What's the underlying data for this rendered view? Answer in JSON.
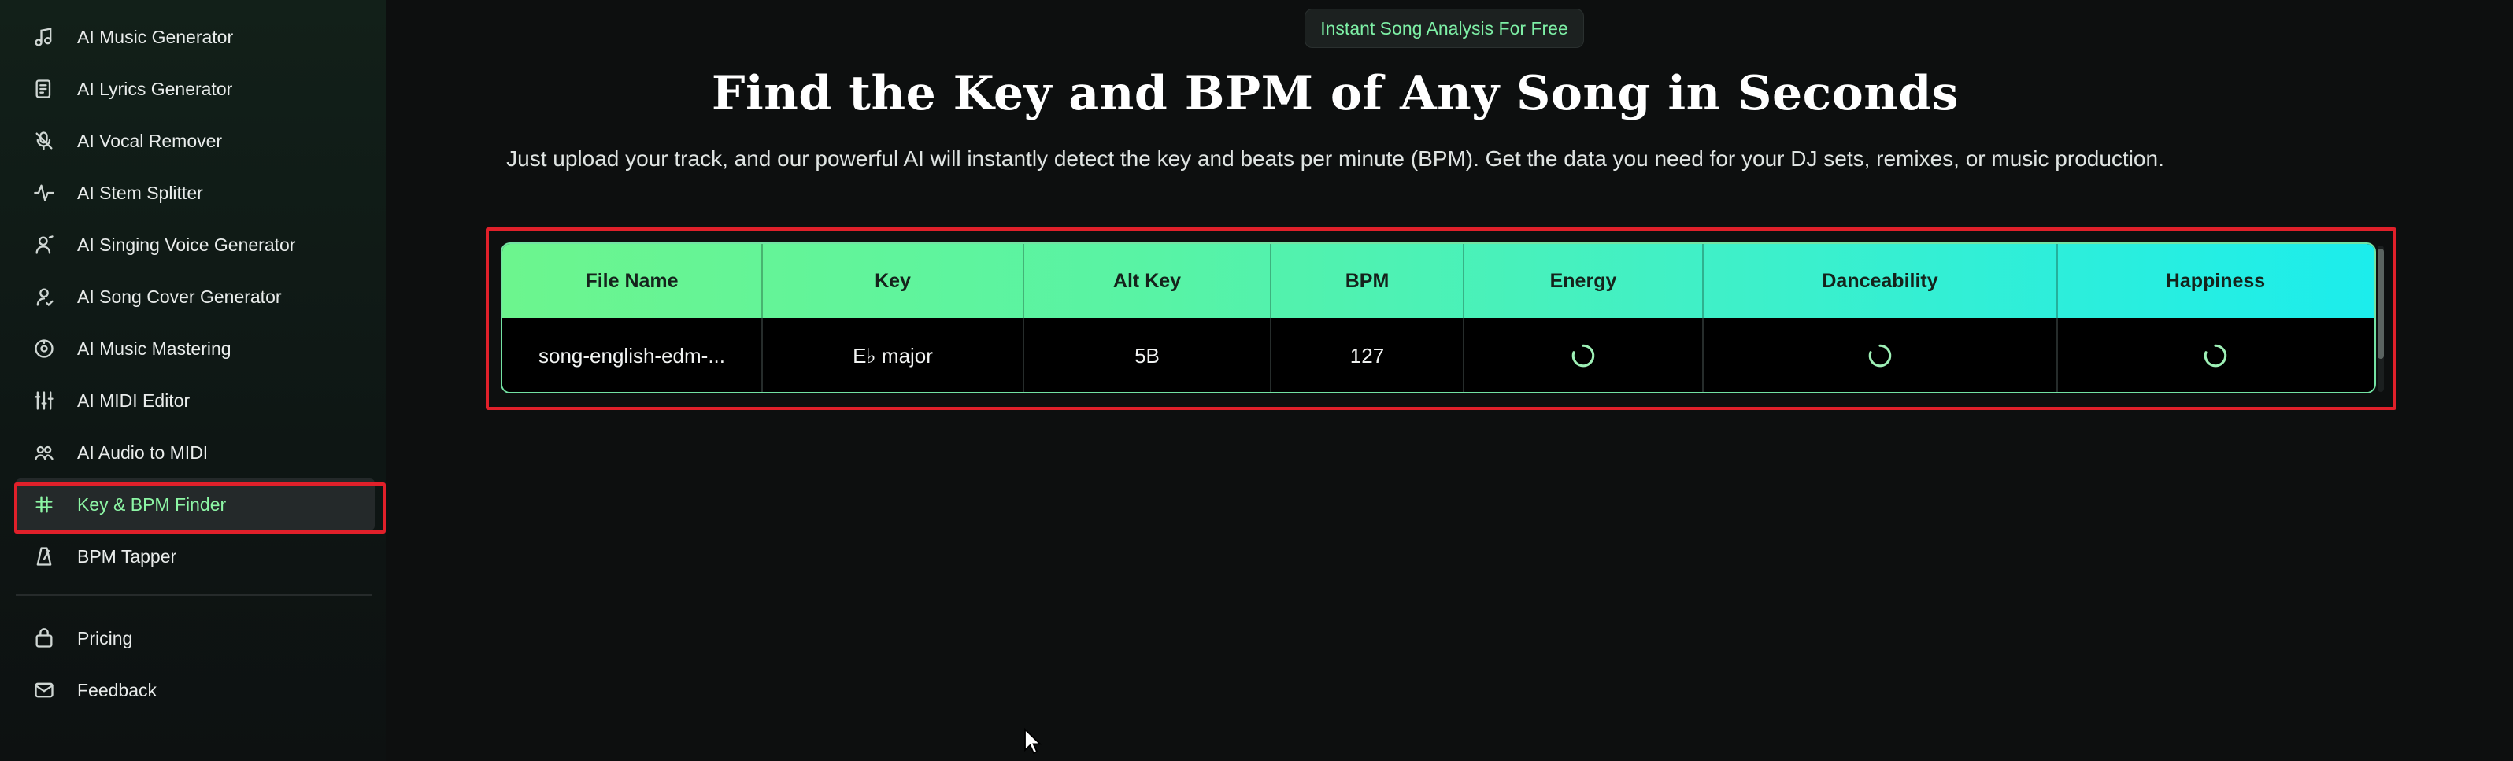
{
  "sidebar": {
    "items": [
      {
        "label": "AI Music Generator",
        "icon": "music-note-icon"
      },
      {
        "label": "AI Lyrics Generator",
        "icon": "lyrics-icon"
      },
      {
        "label": "AI Vocal Remover",
        "icon": "vocal-remover-icon"
      },
      {
        "label": "AI Stem Splitter",
        "icon": "stem-splitter-icon"
      },
      {
        "label": "AI Singing Voice Generator",
        "icon": "singing-voice-icon"
      },
      {
        "label": "AI Song Cover Generator",
        "icon": "song-cover-icon"
      },
      {
        "label": "AI Music Mastering",
        "icon": "mastering-icon"
      },
      {
        "label": "AI MIDI Editor",
        "icon": "sliders-icon"
      },
      {
        "label": "AI Audio to MIDI",
        "icon": "audio-to-midi-icon"
      },
      {
        "label": "Key & BPM Finder",
        "icon": "key-bpm-icon",
        "active": true
      },
      {
        "label": "BPM Tapper",
        "icon": "metronome-icon"
      }
    ],
    "bottom_items": [
      {
        "label": "Pricing",
        "icon": "pricing-icon"
      },
      {
        "label": "Feedback",
        "icon": "feedback-icon"
      }
    ]
  },
  "main": {
    "badge": "Instant Song Analysis For Free",
    "title": "Find the Key and BPM of Any Song in Seconds",
    "subtitle": "Just upload your track, and our powerful AI will instantly detect the key and beats per minute (BPM). Get the data you need for your DJ sets, remixes, or music production."
  },
  "table": {
    "headers": [
      "File Name",
      "Key",
      "Alt Key",
      "BPM",
      "Energy",
      "Danceability",
      "Happiness"
    ],
    "rows": [
      {
        "file_name": "song-english-edm-...",
        "key": "E♭ major",
        "alt_key": "5B",
        "bpm": "127",
        "energy_status": "loading",
        "danceability_status": "loading",
        "happiness_status": "loading"
      }
    ]
  },
  "colors": {
    "accent": "#8df6a5",
    "header_gradient_start": "#6cf58e",
    "header_gradient_end": "#1cedec",
    "highlight": "#e0202a",
    "background": "#0d0f0f"
  }
}
